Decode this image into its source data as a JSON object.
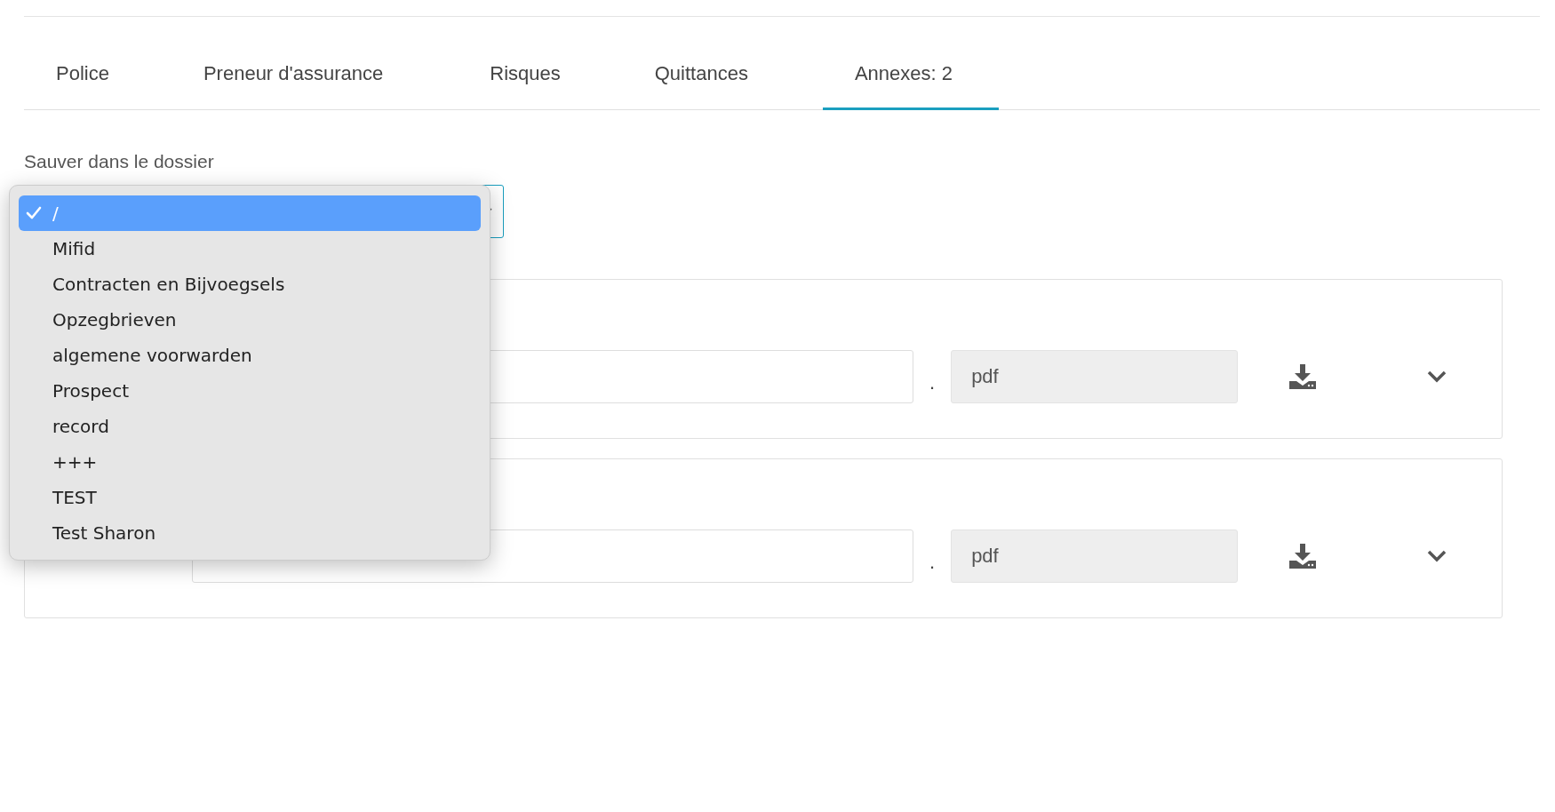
{
  "tabs": [
    {
      "label": "Police",
      "selected": false
    },
    {
      "label": "Preneur d'assurance",
      "selected": false
    },
    {
      "label": "Risques",
      "selected": false
    },
    {
      "label": "Quittances",
      "selected": false
    },
    {
      "label": "Annexes: 2",
      "selected": true
    }
  ],
  "folder": {
    "label": "Sauver dans le dossier",
    "expanded": true,
    "options": [
      {
        "label": "/",
        "selected": true
      },
      {
        "label": "Mifid",
        "selected": false
      },
      {
        "label": "Contracten en Bijvoegsels",
        "selected": false
      },
      {
        "label": "Opzegbrieven",
        "selected": false
      },
      {
        "label": "algemene voorwarden",
        "selected": false
      },
      {
        "label": "Prospect",
        "selected": false
      },
      {
        "label": "record",
        "selected": false
      },
      {
        "label": "+++",
        "selected": false
      },
      {
        "label": "TEST",
        "selected": false
      },
      {
        "label": "Test Sharon",
        "selected": false
      }
    ]
  },
  "attachments": [
    {
      "separator": ".",
      "extension": "pdf"
    },
    {
      "separator": ".",
      "extension": "pdf"
    }
  ]
}
